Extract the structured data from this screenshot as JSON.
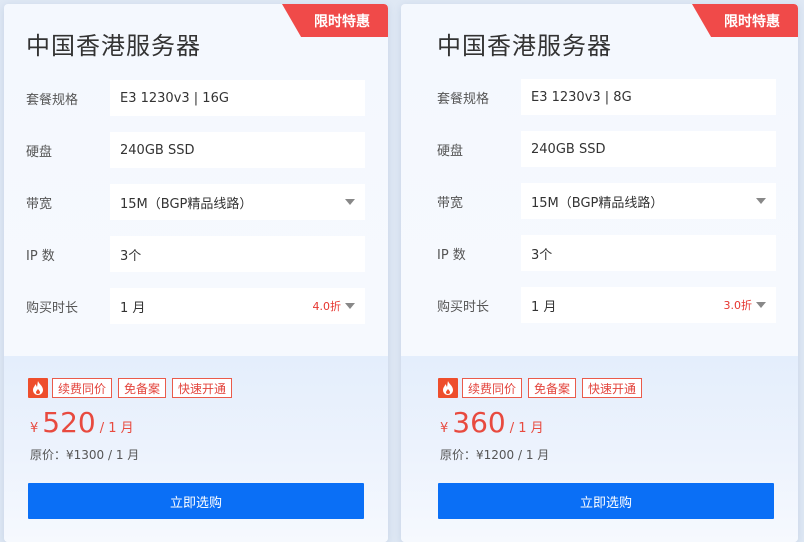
{
  "cards": [
    {
      "badge": "限时特惠",
      "title": "中国香港服务器",
      "rows": [
        {
          "label": "套餐规格",
          "value": "E3 1230v3 | 16G"
        },
        {
          "label": "硬盘",
          "value": "240GB SSD"
        },
        {
          "label": "带宽",
          "value": "15M（BGP精品线路）"
        },
        {
          "label": "IP 数",
          "value": "3个"
        },
        {
          "label": "购买时长",
          "value": "1 月",
          "discount": "4.0折"
        }
      ],
      "tags": [
        "续费同价",
        "免备案",
        "快速开通"
      ],
      "currency": "¥",
      "price": "520",
      "per": "/ 1 月",
      "original": "原价：¥1300 / 1 月",
      "buy_label": "立即选购"
    },
    {
      "badge": "限时特惠",
      "title": "中国香港服务器",
      "rows": [
        {
          "label": "套餐规格",
          "value": "E3 1230v3 | 8G"
        },
        {
          "label": "硬盘",
          "value": "240GB SSD"
        },
        {
          "label": "带宽",
          "value": "15M（BGP精品线路）"
        },
        {
          "label": "IP 数",
          "value": "3个"
        },
        {
          "label": "购买时长",
          "value": "1 月",
          "discount": "3.0折"
        }
      ],
      "tags": [
        "续费同价",
        "免备案",
        "快速开通"
      ],
      "currency": "¥",
      "price": "360",
      "per": "/ 1 月",
      "original": "原价：¥1200 / 1 月",
      "buy_label": "立即选购"
    }
  ],
  "colors": {
    "accent": "#0a6ff6",
    "badge": "#f04a49",
    "price": "#e84a3f"
  },
  "icons": {
    "tag_icon": "fire-icon",
    "dropdown_icon": "chevron-down-icon"
  }
}
